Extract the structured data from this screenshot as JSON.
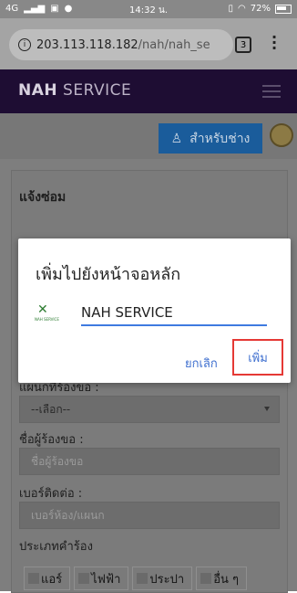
{
  "status_bar": {
    "network": "4G",
    "time": "14:32 น.",
    "battery": "72%"
  },
  "browser": {
    "url_host": "203.113.118.182",
    "url_path": "/nah/nah_se",
    "tab_count": "3"
  },
  "site": {
    "brand_bold": "NAH",
    "brand_rest": "SERVICE",
    "tech_button_label": "สำหรับช่าง"
  },
  "form": {
    "title": "แจ้งซ่อม",
    "dept_label": "แผนกที่ร้องขอ :",
    "dept_value": "--เลือก--",
    "requester_label": "ชื่อผู้ร้องขอ :",
    "requester_placeholder": "ชื่อผู้ร้องขอ",
    "phone_label": "เบอร์ติดต่อ :",
    "phone_placeholder": "เบอร์ห้อง/แผนก",
    "type_label": "ประเภทคำร้อง",
    "types": [
      "แอร์",
      "ไฟฟ้า",
      "ประปา",
      "อื่น ๆ"
    ]
  },
  "dialog": {
    "title": "เพิ่มไปยังหน้าจอหลัก",
    "app_name": "NAH SERVICE",
    "icon_caption": "NAH SERVICE",
    "cancel_label": "ยกเลิก",
    "add_label": "เพิ่ม",
    "highlight_color": "#e53935"
  }
}
